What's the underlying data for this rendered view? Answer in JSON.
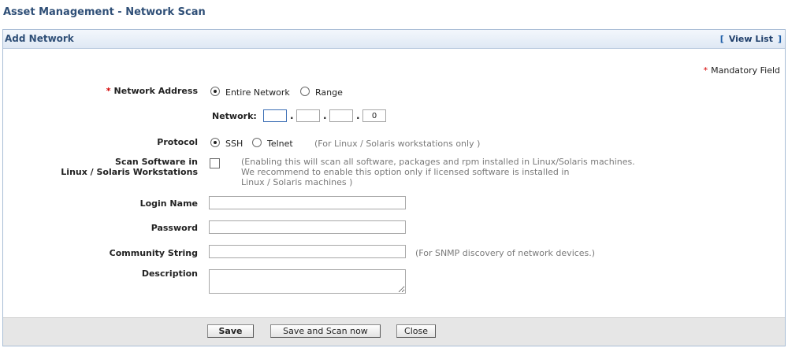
{
  "page": {
    "title": "Asset Management - Network Scan"
  },
  "panel": {
    "title": "Add Network",
    "view_list": {
      "open": "[",
      "label": "View List",
      "close": "]"
    },
    "mandatory": {
      "star": "*",
      "text": "Mandatory Field"
    }
  },
  "form": {
    "network_address": {
      "star": "*",
      "label": "Network Address",
      "options": [
        {
          "label": "Entire Network",
          "selected": true
        },
        {
          "label": "Range",
          "selected": false
        }
      ],
      "network_label": "Network:",
      "octets": [
        "",
        "",
        "",
        "0"
      ],
      "separator": "."
    },
    "protocol": {
      "label": "Protocol",
      "options": [
        {
          "label": "SSH",
          "selected": true
        },
        {
          "label": "Telnet",
          "selected": false
        }
      ],
      "hint": "(For Linux / Solaris workstations only )"
    },
    "scan_software": {
      "label_line1": "Scan Software in",
      "label_line2": "Linux / Solaris Workstations",
      "checked": false,
      "hint_line1": "(Enabling this will scan all software, packages and rpm installed in Linux/Solaris machines.",
      "hint_line2": "We recommend to enable this option only if licensed software is installed in",
      "hint_line3": "Linux / Solaris machines )"
    },
    "login_name": {
      "label": "Login Name",
      "value": ""
    },
    "password": {
      "label": "Password",
      "value": ""
    },
    "community_string": {
      "label": "Community String",
      "value": "",
      "hint": "(For SNMP discovery of network devices.)"
    },
    "description": {
      "label": "Description",
      "value": ""
    }
  },
  "buttons": {
    "save": "Save",
    "save_and_scan": "Save and Scan now",
    "close": "Close"
  }
}
